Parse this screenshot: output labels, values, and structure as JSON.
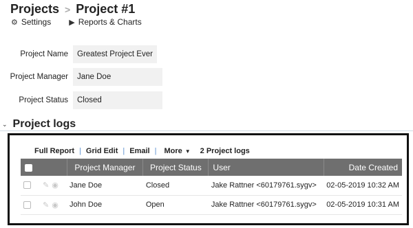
{
  "breadcrumb": {
    "root": "Projects",
    "separator": ">",
    "current": "Project #1"
  },
  "subnav": {
    "settings": "Settings",
    "reports": "Reports & Charts"
  },
  "fields": [
    {
      "label": "Project Name",
      "value": "Greatest Project Ever"
    },
    {
      "label": "Project Manager",
      "value": "Jane Doe"
    },
    {
      "label": "Project Status",
      "value": "Closed"
    }
  ],
  "logs": {
    "title": "Project logs",
    "toolbar": {
      "full_report": "Full Report",
      "grid_edit": "Grid Edit",
      "email": "Email",
      "more": "More",
      "count": "2 Project logs"
    },
    "columns": [
      "Project Manager",
      "Project Status",
      "User",
      "Date Created"
    ],
    "rows": [
      {
        "manager": "Jane Doe",
        "status": "Closed",
        "user": "Jake Rattner <60179761.sygv>",
        "date": "02-05-2019 10:32 AM"
      },
      {
        "manager": "John Doe",
        "status": "Open",
        "user": "Jake Rattner <60179761.sygv>",
        "date": "02-05-2019 10:31 AM"
      }
    ]
  }
}
